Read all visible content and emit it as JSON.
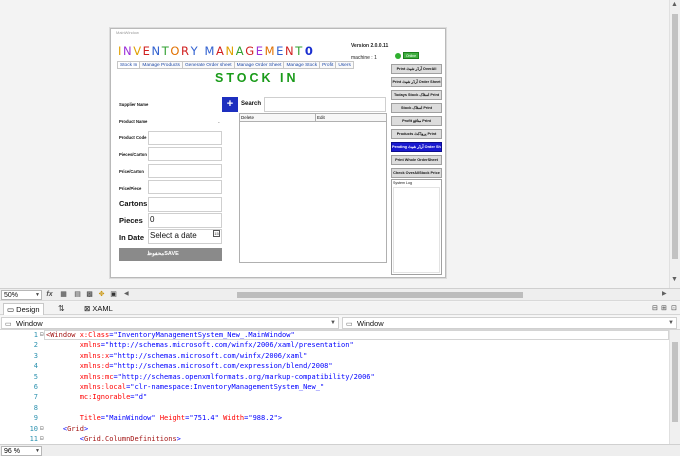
{
  "designer": {
    "window_title": "MainWindow",
    "app_title_letters": [
      {
        "ch": "I",
        "color": "#e0a000"
      },
      {
        "ch": "N",
        "color": "#9b30d9"
      },
      {
        "ch": "V",
        "color": "#e0a000"
      },
      {
        "ch": "E",
        "color": "#d02020"
      },
      {
        "ch": "N",
        "color": "#3060d0"
      },
      {
        "ch": "T",
        "color": "#30a030"
      },
      {
        "ch": "O",
        "color": "#e07000"
      },
      {
        "ch": "R",
        "color": "#d02020"
      },
      {
        "ch": "Y",
        "color": "#3060d0"
      },
      {
        "ch": " ",
        "color": "#000000"
      },
      {
        "ch": "M",
        "color": "#3060d0"
      },
      {
        "ch": "A",
        "color": "#d02020"
      },
      {
        "ch": "N",
        "color": "#e0a000"
      },
      {
        "ch": "A",
        "color": "#30a030"
      },
      {
        "ch": "G",
        "color": "#d02020"
      },
      {
        "ch": "E",
        "color": "#9b30d9"
      },
      {
        "ch": "M",
        "color": "#e07000"
      },
      {
        "ch": "E",
        "color": "#3060d0"
      },
      {
        "ch": "N",
        "color": "#d02020"
      },
      {
        "ch": "T",
        "color": "#30a030"
      }
    ],
    "app_title_suffix": "0",
    "version": "Version 2.0.0.11",
    "machine": "machine : 1",
    "status_badge": "Online",
    "tabs": [
      "Stock In",
      "Manage Products",
      "Generate Order sheet",
      "Manage Order Sheet",
      "Manage Stock",
      "Profit",
      "Users"
    ],
    "page_heading": "STOCK IN",
    "form": {
      "supplier_name": "Supplier Name",
      "product_name": "Product Name",
      "product_name_value": "-",
      "product_code": "Product Code",
      "pieces_carton": "Pieces/Carton",
      "price_carton": "Price/Carton",
      "price_piece": "Price/Piece",
      "cartons": "Cartons",
      "pieces": "Pieces",
      "pieces_value": "0",
      "in_date": "In Date",
      "date_placeholder": "Select a date",
      "calendar_glyph": "15",
      "save_button": "محفوظSAVE"
    },
    "plus_button": "+",
    "search_label": "Search",
    "grid_columns": [
      "Delete",
      "Edit"
    ],
    "side_buttons": [
      {
        "label": "Print آرڈر شیٹ OverAll",
        "blue": false
      },
      {
        "label": "Print آرڈر شیٹ Order Sheet",
        "blue": false
      },
      {
        "label": "Todays Stock اسٹاک Print",
        "blue": false
      },
      {
        "label": "Stock اسٹاک Print",
        "blue": false
      },
      {
        "label": "Profit منافع Print",
        "blue": false
      },
      {
        "label": "Products پروڈکٹ Print",
        "blue": false
      },
      {
        "label": "Pending آرڈر شیٹ Order Sheet",
        "blue": true
      },
      {
        "label": "Print Whole OrderSheet",
        "blue": false
      },
      {
        "label": "Check OverAllStock Price",
        "blue": false
      }
    ],
    "system_log_title": "System Log"
  },
  "toolbar": {
    "zoom": "50%",
    "fx_label": "fx"
  },
  "view_tabs": {
    "design": "Design",
    "xaml": "XAML",
    "swap_glyph": "⇅"
  },
  "nav": {
    "left_combo": "Window",
    "right_combo": "Window"
  },
  "editor": {
    "lines": [
      {
        "no": "1",
        "fold": "⊟",
        "parts": [
          [
            "tag",
            "<Window "
          ],
          [
            "attr",
            "x:Class"
          ],
          [
            "punc",
            "=\""
          ],
          [
            "val",
            "InventoryManagementSystem_New_.MainWindow"
          ],
          [
            "punc",
            "\""
          ]
        ]
      },
      {
        "no": "2",
        "fold": "",
        "parts": [
          [
            "attr",
            "        xmlns"
          ],
          [
            "punc",
            "=\""
          ],
          [
            "val",
            "http://schemas.microsoft.com/winfx/2006/xaml/presentation"
          ],
          [
            "punc",
            "\""
          ]
        ]
      },
      {
        "no": "3",
        "fold": "",
        "parts": [
          [
            "attr",
            "        xmlns:x"
          ],
          [
            "punc",
            "=\""
          ],
          [
            "val",
            "http://schemas.microsoft.com/winfx/2006/xaml"
          ],
          [
            "punc",
            "\""
          ]
        ]
      },
      {
        "no": "4",
        "fold": "",
        "parts": [
          [
            "attr",
            "        xmlns:d"
          ],
          [
            "punc",
            "=\""
          ],
          [
            "val",
            "http://schemas.microsoft.com/expression/blend/2008"
          ],
          [
            "punc",
            "\""
          ]
        ]
      },
      {
        "no": "5",
        "fold": "",
        "parts": [
          [
            "attr",
            "        xmlns:mc"
          ],
          [
            "punc",
            "=\""
          ],
          [
            "val",
            "http://schemas.openxmlformats.org/markup-compatibility/2006"
          ],
          [
            "punc",
            "\""
          ]
        ]
      },
      {
        "no": "6",
        "fold": "",
        "parts": [
          [
            "attr",
            "        xmlns:local"
          ],
          [
            "punc",
            "=\""
          ],
          [
            "val",
            "clr-namespace:InventoryManagementSystem_New_"
          ],
          [
            "punc",
            "\""
          ]
        ]
      },
      {
        "no": "7",
        "fold": "",
        "parts": [
          [
            "attr",
            "        mc:Ignorable"
          ],
          [
            "punc",
            "=\""
          ],
          [
            "val",
            "d"
          ],
          [
            "punc",
            "\""
          ]
        ]
      },
      {
        "no": "8",
        "fold": "",
        "parts": []
      },
      {
        "no": "9",
        "fold": "",
        "parts": [
          [
            "attr",
            "        Title"
          ],
          [
            "punc",
            "=\""
          ],
          [
            "val",
            "MainWindow"
          ],
          [
            "punc",
            "\" "
          ],
          [
            "attr",
            "Height"
          ],
          [
            "punc",
            "=\""
          ],
          [
            "val",
            "751.4"
          ],
          [
            "punc",
            "\" "
          ],
          [
            "attr",
            "Width"
          ],
          [
            "punc",
            "=\""
          ],
          [
            "val",
            "988.2"
          ],
          [
            "punc",
            "\">"
          ]
        ]
      },
      {
        "no": "10",
        "fold": "⊟",
        "parts": [
          [
            "punc",
            "    <"
          ],
          [
            "tag",
            "Grid"
          ],
          [
            "punc",
            ">"
          ]
        ]
      },
      {
        "no": "11",
        "fold": "⊟",
        "parts": [
          [
            "punc",
            "        <"
          ],
          [
            "tag",
            "Grid.ColumnDefinitions"
          ],
          [
            "punc",
            ">"
          ]
        ]
      }
    ]
  },
  "status": {
    "zoom": "96 %"
  }
}
